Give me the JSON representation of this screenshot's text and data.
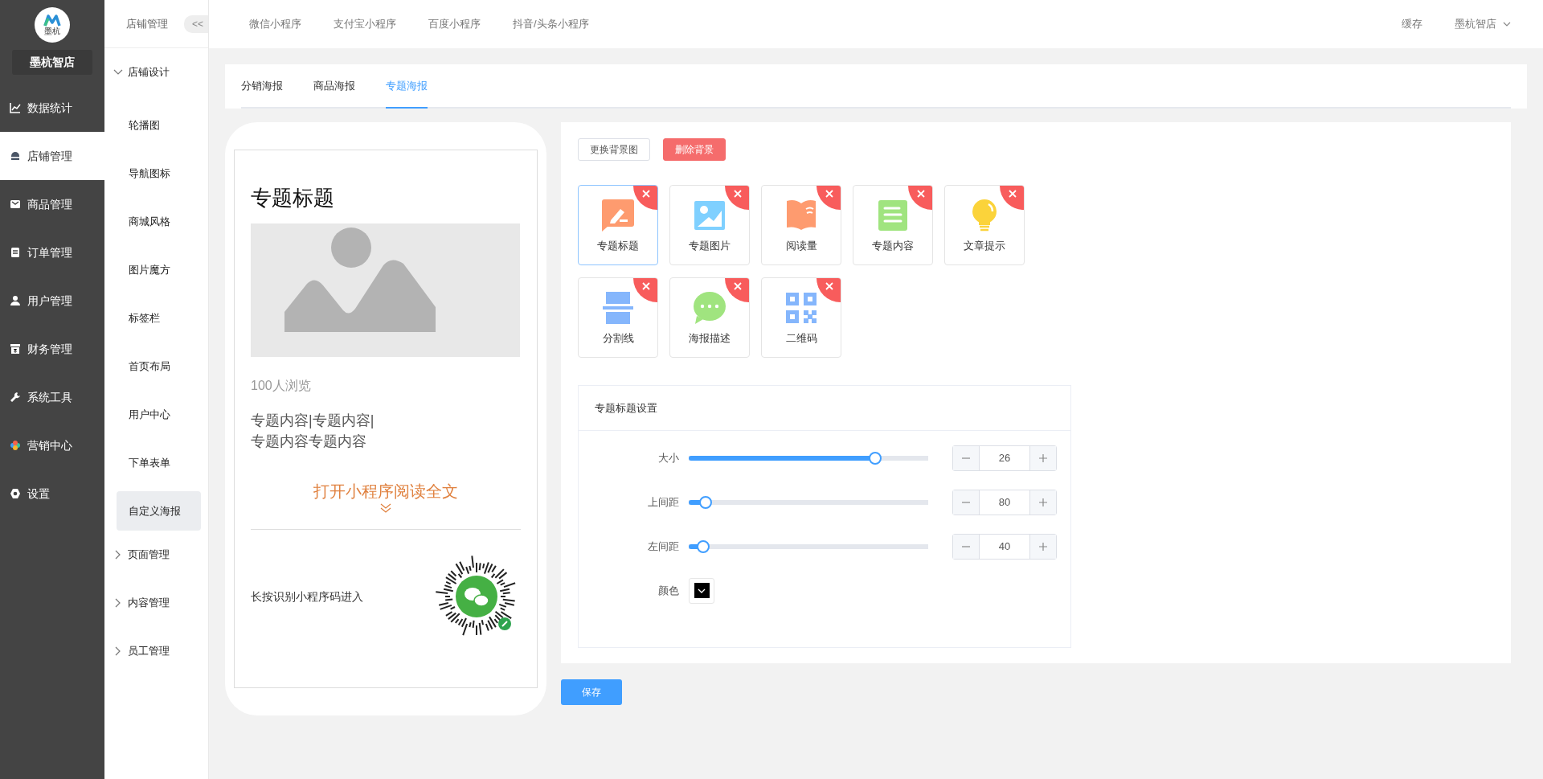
{
  "brand": {
    "logo_text": "墨杭",
    "name": "墨杭智店"
  },
  "sidebar": {
    "items": [
      {
        "label": "数据统计",
        "selected": false
      },
      {
        "label": "店铺管理",
        "selected": true
      },
      {
        "label": "商品管理",
        "selected": false
      },
      {
        "label": "订单管理",
        "selected": false
      },
      {
        "label": "用户管理",
        "selected": false
      },
      {
        "label": "财务管理",
        "selected": false
      },
      {
        "label": "系统工具",
        "selected": false
      },
      {
        "label": "营销中心",
        "selected": false
      },
      {
        "label": "设置",
        "selected": false
      }
    ]
  },
  "subnav": {
    "title": "店铺管理",
    "collapse_label": "<<",
    "groups": [
      {
        "label": "店铺设计",
        "expanded": true,
        "children": [
          {
            "label": "轮播图",
            "selected": false
          },
          {
            "label": "导航图标",
            "selected": false
          },
          {
            "label": "商城风格",
            "selected": false
          },
          {
            "label": "图片魔方",
            "selected": false
          },
          {
            "label": "标签栏",
            "selected": false
          },
          {
            "label": "首页布局",
            "selected": false
          },
          {
            "label": "用户中心",
            "selected": false
          },
          {
            "label": "下单表单",
            "selected": false
          },
          {
            "label": "自定义海报",
            "selected": true
          }
        ]
      },
      {
        "label": "页面管理",
        "expanded": false
      },
      {
        "label": "内容管理",
        "expanded": false
      },
      {
        "label": "员工管理",
        "expanded": false
      }
    ]
  },
  "topbar": {
    "items": [
      "微信小程序",
      "支付宝小程序",
      "百度小程序",
      "抖音/头条小程序"
    ],
    "cache": "缓存",
    "user": "墨杭智店"
  },
  "tabs": [
    {
      "label": "分销海报",
      "selected": false
    },
    {
      "label": "商品海报",
      "selected": false
    },
    {
      "label": "专题海报",
      "selected": true
    }
  ],
  "preview": {
    "title": "专题标题",
    "views": "100人浏览",
    "content_lines": [
      "专题内容|专题内容|",
      "专题内容专题内容"
    ],
    "read_more": "打开小程序阅读全文",
    "footer": "长按识别小程序码进入"
  },
  "actions": [
    {
      "label": "更换背景图",
      "kind": "default"
    },
    {
      "label": "删除背景",
      "kind": "danger"
    }
  ],
  "components": [
    {
      "label": "专题标题",
      "kind": "title",
      "selected": true
    },
    {
      "label": "专题图片",
      "kind": "image",
      "selected": false
    },
    {
      "label": "阅读量",
      "kind": "views",
      "selected": false
    },
    {
      "label": "专题内容",
      "kind": "content",
      "selected": false
    },
    {
      "label": "文章提示",
      "kind": "tip",
      "selected": false
    },
    {
      "label": "分割线",
      "kind": "divider",
      "selected": false
    },
    {
      "label": "海报描述",
      "kind": "description",
      "selected": false
    },
    {
      "label": "二维码",
      "kind": "qrcode",
      "selected": false
    }
  ],
  "settings": {
    "title": "专题标题设置",
    "rows": [
      {
        "label": "大小",
        "kind": "slider",
        "level": 0.78,
        "value": "26"
      },
      {
        "label": "上间距",
        "kind": "slider",
        "level": 0.07,
        "value": "80"
      },
      {
        "label": "左间距",
        "kind": "slider",
        "level": 0.06,
        "value": "40"
      },
      {
        "label": "颜色",
        "kind": "color",
        "color": "#000000"
      }
    ]
  },
  "save_button": "保存"
}
